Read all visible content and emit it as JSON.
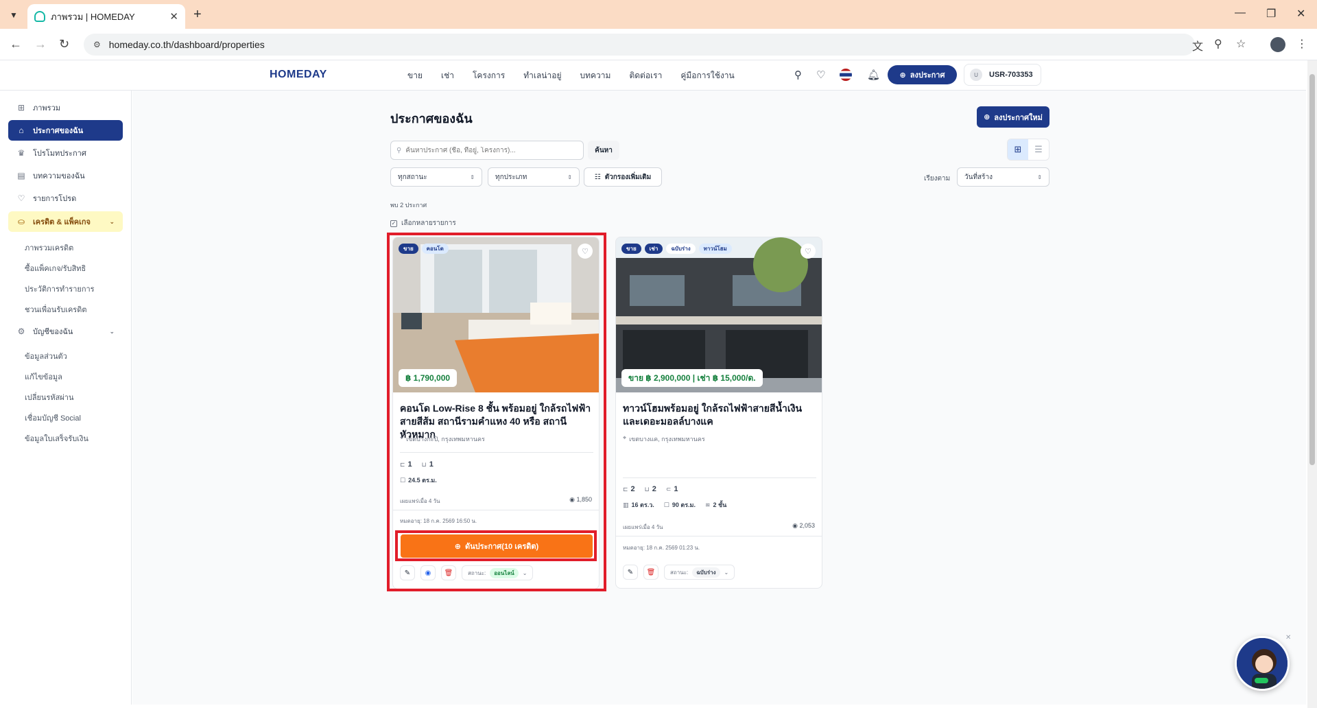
{
  "browser": {
    "tab_title": "ภาพรวม | HOMEDAY",
    "url": "homeday.co.th/dashboard/properties"
  },
  "header": {
    "logo": "HOMEDAY",
    "nav": [
      "ขาย",
      "เช่า",
      "โครงการ",
      "ทำเลน่าอยู่",
      "บทความ",
      "ติดต่อเรา",
      "คู่มือการใช้งาน"
    ],
    "post_button": "ลงประกาศ",
    "user_initial": "U",
    "user_id": "USR-703353"
  },
  "sidebar": {
    "items": [
      {
        "label": "ภาพรวม",
        "icon": "grid-icon"
      },
      {
        "label": "ประกาศของฉัน",
        "icon": "home-icon"
      },
      {
        "label": "โปรโมทประกาศ",
        "icon": "crown-icon"
      },
      {
        "label": "บทความของฉัน",
        "icon": "document-icon"
      },
      {
        "label": "รายการโปรด",
        "icon": "heart-icon"
      }
    ],
    "credit_group": {
      "label": "เครดิต & แพ็คเกจ",
      "icon": "coins-icon",
      "subitems": [
        "ภาพรวมเครดิต",
        "ซื้อแพ็คเกจ/รับสิทธิ",
        "ประวัติการทำรายการ",
        "ชวนเพื่อนรับเครดิต"
      ]
    },
    "account_group": {
      "label": "บัญชีของฉัน",
      "icon": "gear-icon",
      "subitems": [
        "ข้อมูลส่วนตัว",
        "แก้ไขข้อมูล",
        "เปลี่ยนรหัสผ่าน",
        "เชื่อมบัญชี Social",
        "ข้อมูลใบเสร็จรับเงิน"
      ]
    }
  },
  "main": {
    "title": "ประกาศของฉัน",
    "new_post_button": "ลงประกาศใหม่",
    "search_placeholder": "ค้นหาประกาศ (ชื่อ, ที่อยู่, โครงการ)...",
    "search_button": "ค้นหา",
    "filter_status": "ทุกสถานะ",
    "filter_type": "ทุกประเภท",
    "more_filters": "ตัวกรองเพิ่มเติม",
    "sort_label": "เรียงตาม",
    "sort_value": "วันที่สร้าง",
    "count_text": "พบ 2 ประกาศ",
    "multi_select": "เลือกหลายรายการ"
  },
  "cards": [
    {
      "tags": [
        "ขาย",
        "คอนโด"
      ],
      "price": "฿ 1,790,000",
      "title": "คอนโด Low-Rise 8 ชั้น พร้อมอยู่ ใกล้รถไฟฟ้าสายสีส้ม สถานีรามคำแหง 40 หรือ สถานีหัวหมาก",
      "location": "เขตบางกะปิ, กรุงเทพมหานคร",
      "bedrooms": "1",
      "bathrooms": "1",
      "area": "24.5 ตร.ม.",
      "updated": "เผยแพร่เมื่อ 4 วัน",
      "views": "1,850",
      "expire": "หมดอายุ: 18 ก.ค. 2569 16:50 น.",
      "boost_button": "ดันประกาศ(10 เครดิต)",
      "status_label": "สถานะ:",
      "status_value": "ออนไลน์"
    },
    {
      "tags": [
        "ขาย",
        "เช่า",
        "ฉบับร่าง",
        "ทาวน์โฮม"
      ],
      "price": "ขาย ฿ 2,900,000 | เช่า ฿ 15,000/ด.",
      "title": "ทาวน์โฮมพร้อมอยู่ ใกล้รถไฟฟ้าสายสีน้ำเงิน และเดอะมอลล์บางแค",
      "location": "เขตบางแค, กรุงเทพมหานคร",
      "bedrooms": "2",
      "bathrooms": "2",
      "parking": "1",
      "land": "16 ตร.ว.",
      "area": "90 ตร.ม.",
      "floors": "2 ชั้น",
      "updated": "เผยแพร่เมื่อ 4 วัน",
      "views": "2,053",
      "expire": "หมดอายุ: 18 ก.ค. 2569 01:23 น.",
      "status_label": "สถานะ:",
      "status_value": "ฉบับร่าง"
    }
  ]
}
